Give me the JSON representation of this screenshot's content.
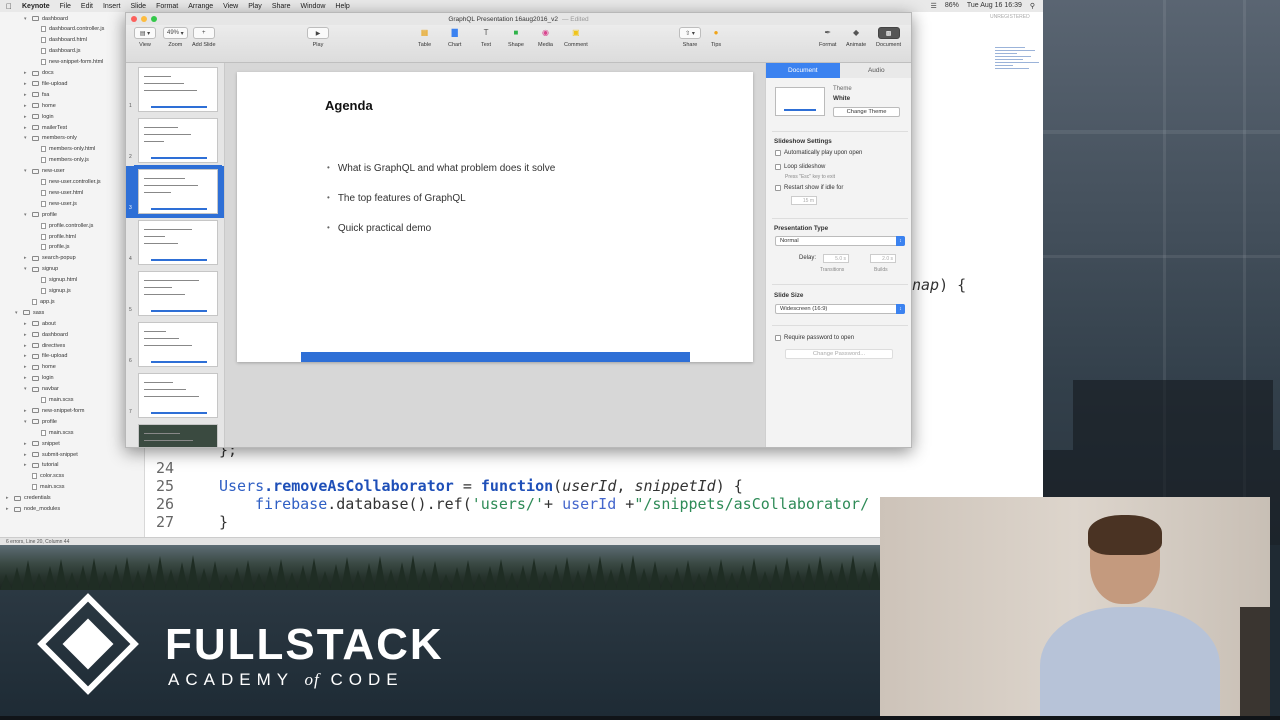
{
  "menubar": {
    "app": "Keynote",
    "items": [
      "File",
      "Edit",
      "Insert",
      "Slide",
      "Format",
      "Arrange",
      "View",
      "Play",
      "Share",
      "Window",
      "Help"
    ],
    "clock": "Tue Aug 16 16:39",
    "battery": "86%"
  },
  "editor": {
    "unregistered": "UNREGISTERED",
    "status": "6 errors, Line 20, Column 44",
    "tree": [
      {
        "label": "dashboard",
        "type": "folder",
        "depth": 2,
        "open": true
      },
      {
        "label": "dashboard.controller.js",
        "type": "file",
        "depth": 3
      },
      {
        "label": "dashboard.html",
        "type": "file",
        "depth": 3
      },
      {
        "label": "dashboard.js",
        "type": "file",
        "depth": 3
      },
      {
        "label": "new-snippet-form.html",
        "type": "file",
        "depth": 3
      },
      {
        "label": "docs",
        "type": "folder",
        "depth": 2
      },
      {
        "label": "file-upload",
        "type": "folder",
        "depth": 2
      },
      {
        "label": "fsa",
        "type": "folder",
        "depth": 2
      },
      {
        "label": "home",
        "type": "folder",
        "depth": 2
      },
      {
        "label": "login",
        "type": "folder",
        "depth": 2
      },
      {
        "label": "mailerTest",
        "type": "folder",
        "depth": 2
      },
      {
        "label": "members-only",
        "type": "folder",
        "depth": 2,
        "open": true
      },
      {
        "label": "members-only.html",
        "type": "file",
        "depth": 3
      },
      {
        "label": "members-only.js",
        "type": "file",
        "depth": 3
      },
      {
        "label": "new-user",
        "type": "folder",
        "depth": 2,
        "open": true
      },
      {
        "label": "new-user.controller.js",
        "type": "file",
        "depth": 3
      },
      {
        "label": "new-user.html",
        "type": "file",
        "depth": 3
      },
      {
        "label": "new-user.js",
        "type": "file",
        "depth": 3
      },
      {
        "label": "profile",
        "type": "folder",
        "depth": 2,
        "open": true
      },
      {
        "label": "profile.controller.js",
        "type": "file",
        "depth": 3
      },
      {
        "label": "profile.html",
        "type": "file",
        "depth": 3
      },
      {
        "label": "profile.js",
        "type": "file",
        "depth": 3
      },
      {
        "label": "search-popup",
        "type": "folder",
        "depth": 2
      },
      {
        "label": "signup",
        "type": "folder",
        "depth": 2,
        "open": true
      },
      {
        "label": "signup.html",
        "type": "file",
        "depth": 3
      },
      {
        "label": "signup.js",
        "type": "file",
        "depth": 3
      },
      {
        "label": "app.js",
        "type": "file",
        "depth": 2
      },
      {
        "label": "sass",
        "type": "folder",
        "depth": 1,
        "open": true
      },
      {
        "label": "about",
        "type": "folder",
        "depth": 2
      },
      {
        "label": "dashboard",
        "type": "folder",
        "depth": 2
      },
      {
        "label": "directives",
        "type": "folder",
        "depth": 2
      },
      {
        "label": "file-upload",
        "type": "folder",
        "depth": 2
      },
      {
        "label": "home",
        "type": "folder",
        "depth": 2
      },
      {
        "label": "login",
        "type": "folder",
        "depth": 2
      },
      {
        "label": "navbar",
        "type": "folder",
        "depth": 2,
        "open": true
      },
      {
        "label": "main.scss",
        "type": "file",
        "depth": 3
      },
      {
        "label": "new-snippet-form",
        "type": "folder",
        "depth": 2
      },
      {
        "label": "profile",
        "type": "folder",
        "depth": 2,
        "open": true
      },
      {
        "label": "main.scss",
        "type": "file",
        "depth": 3
      },
      {
        "label": "snippet",
        "type": "folder",
        "depth": 2
      },
      {
        "label": "submit-snippet",
        "type": "folder",
        "depth": 2
      },
      {
        "label": "tutorial",
        "type": "folder",
        "depth": 2
      },
      {
        "label": "color.scss",
        "type": "file",
        "depth": 2
      },
      {
        "label": "main.scss",
        "type": "file",
        "depth": 2
      },
      {
        "label": "credentials",
        "type": "folder",
        "depth": 0
      },
      {
        "label": "node_modules",
        "type": "folder",
        "depth": 0
      }
    ],
    "code_fragment": {
      "italic": "nap",
      "rest": ") {"
    },
    "code_lines": [
      {
        "no": "",
        "brace": "};"
      },
      {
        "no": "24"
      },
      {
        "no": "25",
        "obj": "Users",
        "method": ".removeAsCollaborator",
        "eq": " = ",
        "kw": "function",
        "open": "(",
        "p1": "userId",
        "comma": ", ",
        "p2": "snippetId",
        "close": ") {"
      },
      {
        "no": "26",
        "fb": "firebase",
        "call": ".database().ref(",
        "str": "'users/'",
        "plus": "+ ",
        "var": "userId",
        "plus2": " +",
        "str2": "\"/snippets/asCollaborator/"
      },
      {
        "no": "27",
        "brace": "}"
      }
    ]
  },
  "keynote": {
    "title": "GraphQL Presentation 16aug2016_v2",
    "edited": "— Edited",
    "toolbar": {
      "view": "View",
      "zoom": "Zoom",
      "zoom_value": "49%",
      "add_slide": "Add Slide",
      "play": "Play",
      "table": "Table",
      "chart": "Chart",
      "text": "Text",
      "shape": "Shape",
      "media": "Media",
      "comment": "Comment",
      "share": "Share",
      "tips": "Tips",
      "format": "Format",
      "animate": "Animate",
      "document": "Document"
    },
    "slide": {
      "title": "Agenda",
      "bullets": [
        "What is GraphQL and what problem does it solve",
        "The top features of GraphQL",
        "Quick practical demo"
      ]
    },
    "slides_count": 8,
    "selected_slide": 3,
    "inspector": {
      "tab_document": "Document",
      "tab_audio": "Audio",
      "theme_label": "Theme",
      "theme_name": "White",
      "change_theme": "Change Theme",
      "slideshow_settings": "Slideshow Settings",
      "auto_play": "Automatically play upon open",
      "loop": "Loop slideshow",
      "loop_hint": "Press \"Esc\" key to exit",
      "restart": "Restart show if idle for",
      "idle_value": "15 m",
      "presentation_type": "Presentation Type",
      "type_value": "Normal",
      "delay": "Delay:",
      "delay_transitions": "5.0 s",
      "delay_builds": "2.0 s",
      "transitions": "Transitions",
      "builds": "Builds",
      "slide_size": "Slide Size",
      "size_value": "Widescreen (16:9)",
      "require_password": "Require password to open",
      "change_password": "Change Password..."
    }
  },
  "branding": {
    "main": "FULLSTACK",
    "sub_before": "ACADEMY",
    "sub_of": "of",
    "sub_after": "CODE"
  }
}
